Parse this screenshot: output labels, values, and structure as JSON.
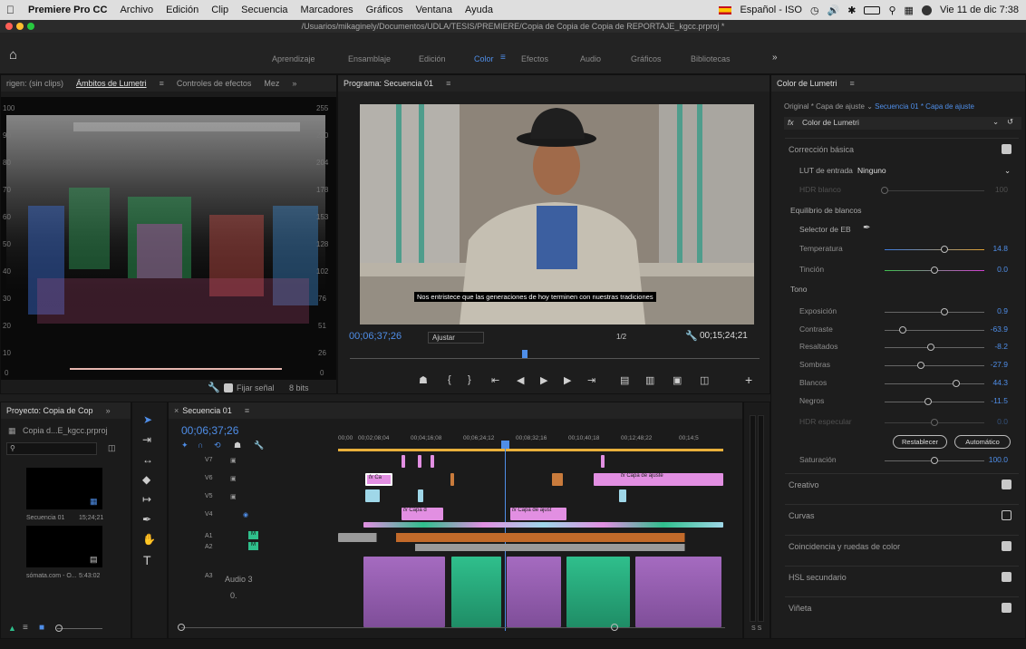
{
  "menubar": {
    "apple": "",
    "app": "Premiere Pro CC",
    "items": [
      "Archivo",
      "Edición",
      "Clip",
      "Secuencia",
      "Marcadores",
      "Gráficos",
      "Ventana",
      "Ayuda"
    ],
    "language": "Español - ISO",
    "datetime": "Vie 11 de dic 7:38"
  },
  "window": {
    "path": "/Usuarios/mikaginely/Documentos/UDLA/TESIS/PREMIERE/Copia de Copia de Copia de REPORTAJE_kgcc.prproj *"
  },
  "workspaces": {
    "items": [
      "Aprendizaje",
      "Ensamblaje",
      "Edición",
      "Color",
      "Efectos",
      "Audio",
      "Gráficos",
      "Bibliotecas"
    ],
    "active": "Color"
  },
  "scopes_panel": {
    "tabs": [
      "rigen: (sin clips)",
      "Ámbitos de Lumetri",
      "Controles de efectos",
      "Mez"
    ],
    "left_ticks": [
      "100",
      "90",
      "80",
      "70",
      "60",
      "50",
      "40",
      "30",
      "20",
      "10",
      "0"
    ],
    "right_ticks": [
      "255",
      "230",
      "204",
      "178",
      "153",
      "128",
      "102",
      "76",
      "51",
      "26",
      "0"
    ],
    "clamp_label": "Fijar señal",
    "bits": "8 bits"
  },
  "program_monitor": {
    "title": "Programa: Secuencia 01",
    "subtitle": "Nos entristece que las generaciones de hoy  terminen con nuestras tradiciones",
    "timecode": "00;06;37;26",
    "fit": "Ajustar",
    "quality": "1/2",
    "duration": "00;15;24;21"
  },
  "project_panel": {
    "title": "Proyecto: Copia de Cop",
    "file": "Copia d...E_kgcc.prproj",
    "items": [
      {
        "name": "Secuencia 01",
        "duration": "15;24;21"
      },
      {
        "name": "sómata.com - O...",
        "duration": "5:43:02"
      }
    ]
  },
  "timeline": {
    "title": "Secuencia 01",
    "timecode": "00;06;37;26",
    "ruler": [
      "00;00",
      "00;02;08;04",
      "00;04;16;08",
      "00;06;24;12",
      "00;08;32;16",
      "00;10;40;18",
      "00;12;48;22",
      "00;14;5"
    ],
    "video_tracks": [
      "V7",
      "V6",
      "V5",
      "V4"
    ],
    "audio_tracks": [
      "A1",
      "A2",
      "A3"
    ],
    "audio3_name": "Audio 3",
    "master": "0.",
    "clip_labels": [
      "Ca",
      "Capa de ajuste",
      "Capa d",
      "Capa de ajust"
    ],
    "fx": "fx",
    "solo": "S S"
  },
  "lumetri": {
    "title": "Color de Lumetri",
    "source": "Original * Capa de ajuste",
    "target": "Secuencia 01 * Capa de ajuste",
    "fx_name": "Color de Lumetri",
    "basic": "Corrección básica",
    "lut_label": "LUT de entrada",
    "lut_value": "Ninguno",
    "hdr_white": "HDR blanco",
    "hdr_white_value": "100",
    "wb_section": "Equilibrio de blancos",
    "wb_selector": "Selector de EB",
    "tone": "Tono",
    "sliders": [
      {
        "label": "Temperatura",
        "value": "14.8",
        "pos": 0.6
      },
      {
        "label": "Tinción",
        "value": "0.0",
        "pos": 0.5
      },
      {
        "label": "Exposición",
        "value": "0.9",
        "pos": 0.6
      },
      {
        "label": "Contraste",
        "value": "-63.9",
        "pos": 0.18
      },
      {
        "label": "Resaltados",
        "value": "-8.2",
        "pos": 0.46
      },
      {
        "label": "Sombras",
        "value": "-27.9",
        "pos": 0.36
      },
      {
        "label": "Blancos",
        "value": "44.3",
        "pos": 0.72
      },
      {
        "label": "Negros",
        "value": "-11.5",
        "pos": 0.44
      },
      {
        "label": "HDR especular",
        "value": "0.0",
        "pos": 0.5
      }
    ],
    "reset": "Restablecer",
    "auto": "Automático",
    "saturation": "Saturación",
    "saturation_value": "100.0",
    "sections": [
      {
        "label": "Creativo",
        "checked": true
      },
      {
        "label": "Curvas",
        "checked": false
      },
      {
        "label": "Coincidencia y ruedas de color",
        "checked": true
      },
      {
        "label": "HSL secundario",
        "checked": true
      },
      {
        "label": "Viñeta",
        "checked": true
      }
    ]
  },
  "colors": {
    "accent_blue": "#4f8ee8",
    "clip_pink": "#e28fe2",
    "clip_cyan": "#9fd7e8",
    "clip_green": "#2fbf8c",
    "audio_purple": "#a56bc0"
  }
}
